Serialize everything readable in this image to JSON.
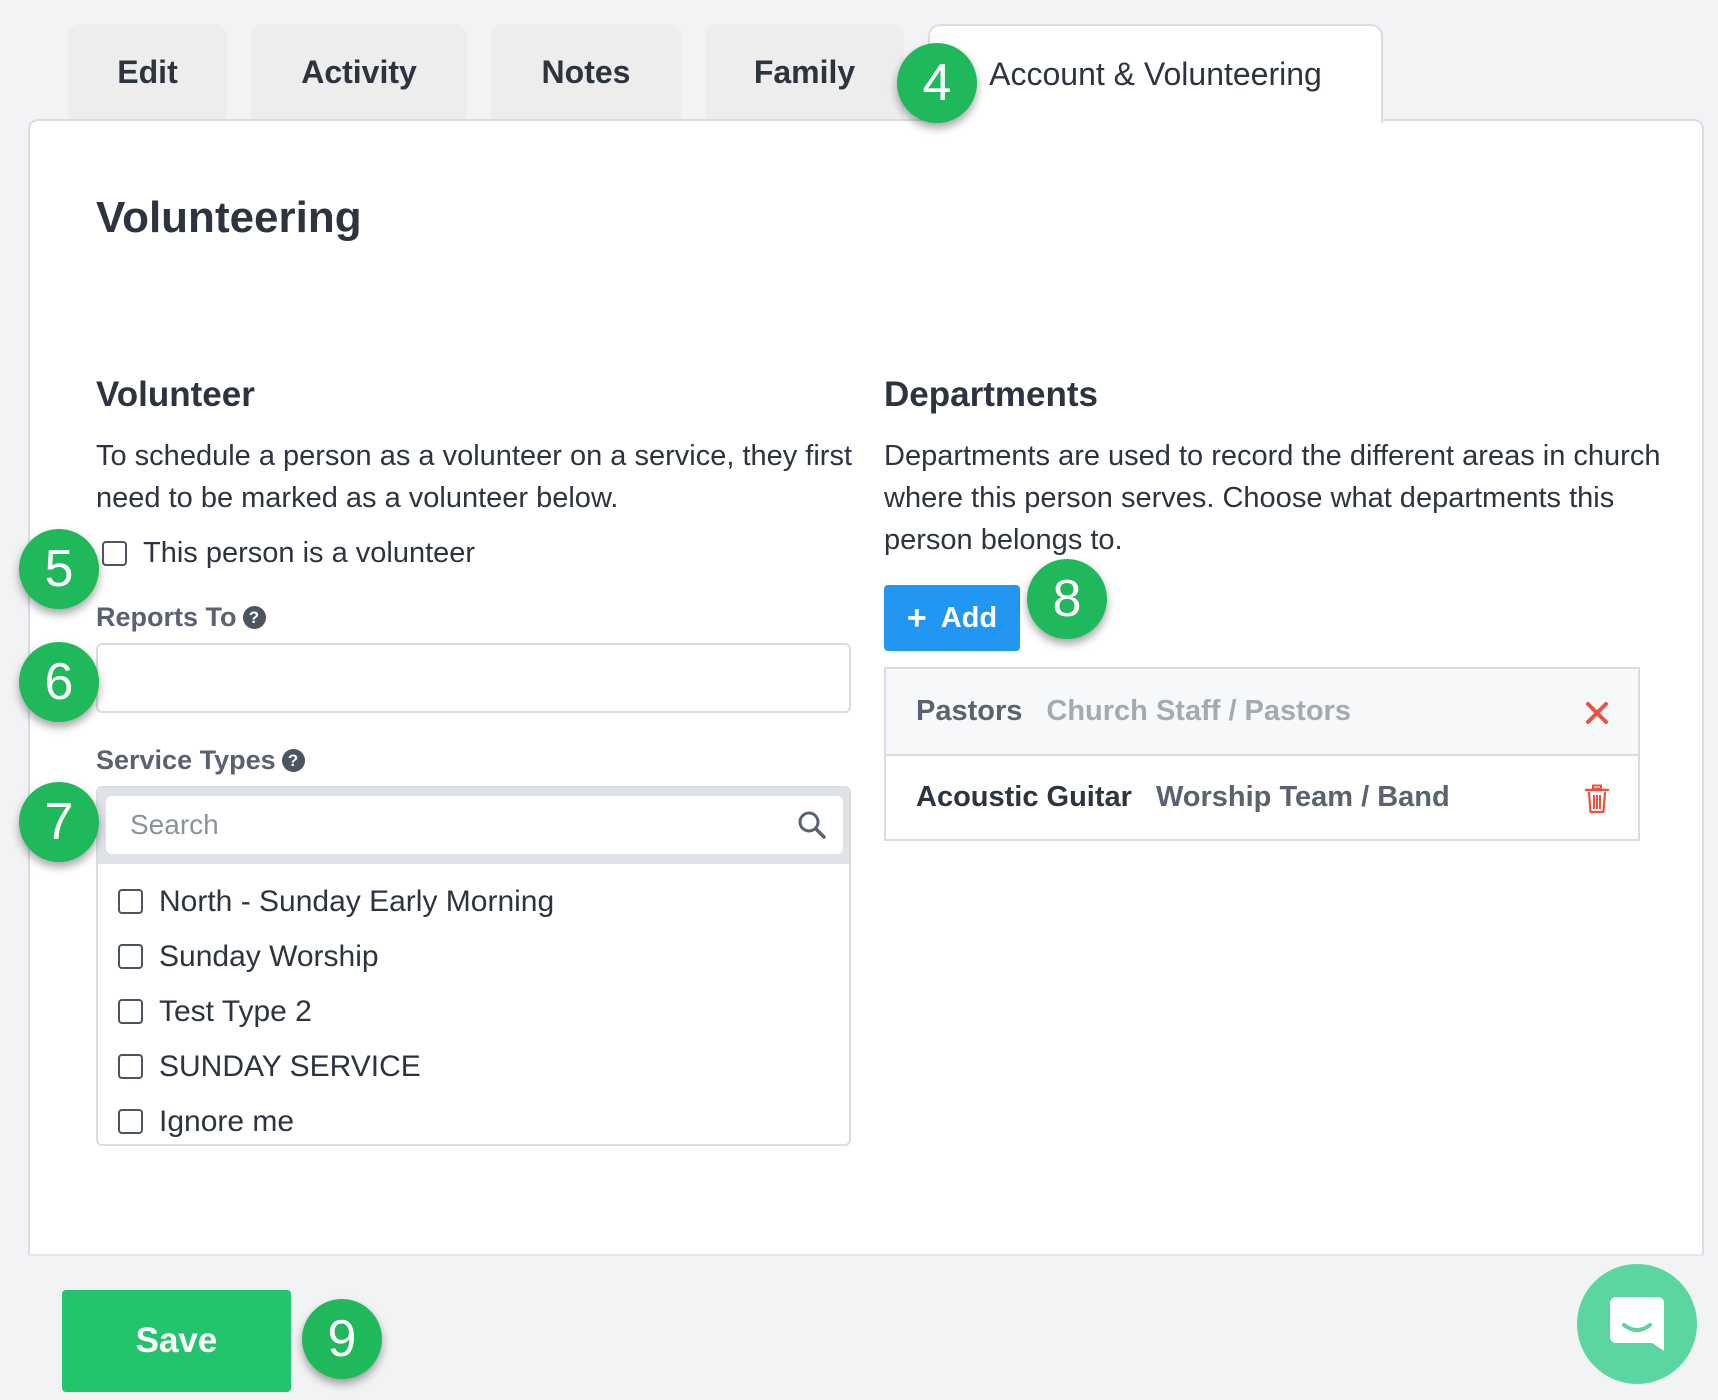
{
  "tabs": [
    {
      "label": "Edit"
    },
    {
      "label": "Activity"
    },
    {
      "label": "Notes"
    },
    {
      "label": "Family"
    },
    {
      "label": "Account & Volunteering"
    }
  ],
  "page": {
    "heading": "Volunteering"
  },
  "volunteer": {
    "title": "Volunteer",
    "description": "To schedule a person as a volunteer on a service, they first need to be marked as a volunteer below.",
    "checkbox_label": "This person is a volunteer",
    "reports_to_label": "Reports To",
    "reports_to_value": "",
    "service_types_label": "Service Types",
    "search_placeholder": "Search",
    "service_types": [
      {
        "label": "North - Sunday Early Morning"
      },
      {
        "label": "Sunday Worship"
      },
      {
        "label": "Test Type 2"
      },
      {
        "label": "SUNDAY SERVICE"
      },
      {
        "label": "Ignore me"
      }
    ]
  },
  "departments": {
    "title": "Departments",
    "description": "Departments are used to record the different areas in church where this person serves. Choose what departments this person belongs to.",
    "add_label": "Add",
    "items": [
      {
        "name": "Pastors",
        "path": "Church Staff / Pastors",
        "action_icon": "close-icon"
      },
      {
        "name": "Acoustic Guitar",
        "path": "Worship Team / Band",
        "action_icon": "trash-icon"
      }
    ]
  },
  "footer": {
    "save_label": "Save"
  },
  "badges": [
    "4",
    "5",
    "6",
    "7",
    "8",
    "9"
  ],
  "colors": {
    "accent_blue": "#2196f3",
    "save_green": "#22c46d",
    "badge_green": "#1fb85a",
    "remove_red": "#e8533f",
    "chat_green": "#5cd6a1"
  }
}
